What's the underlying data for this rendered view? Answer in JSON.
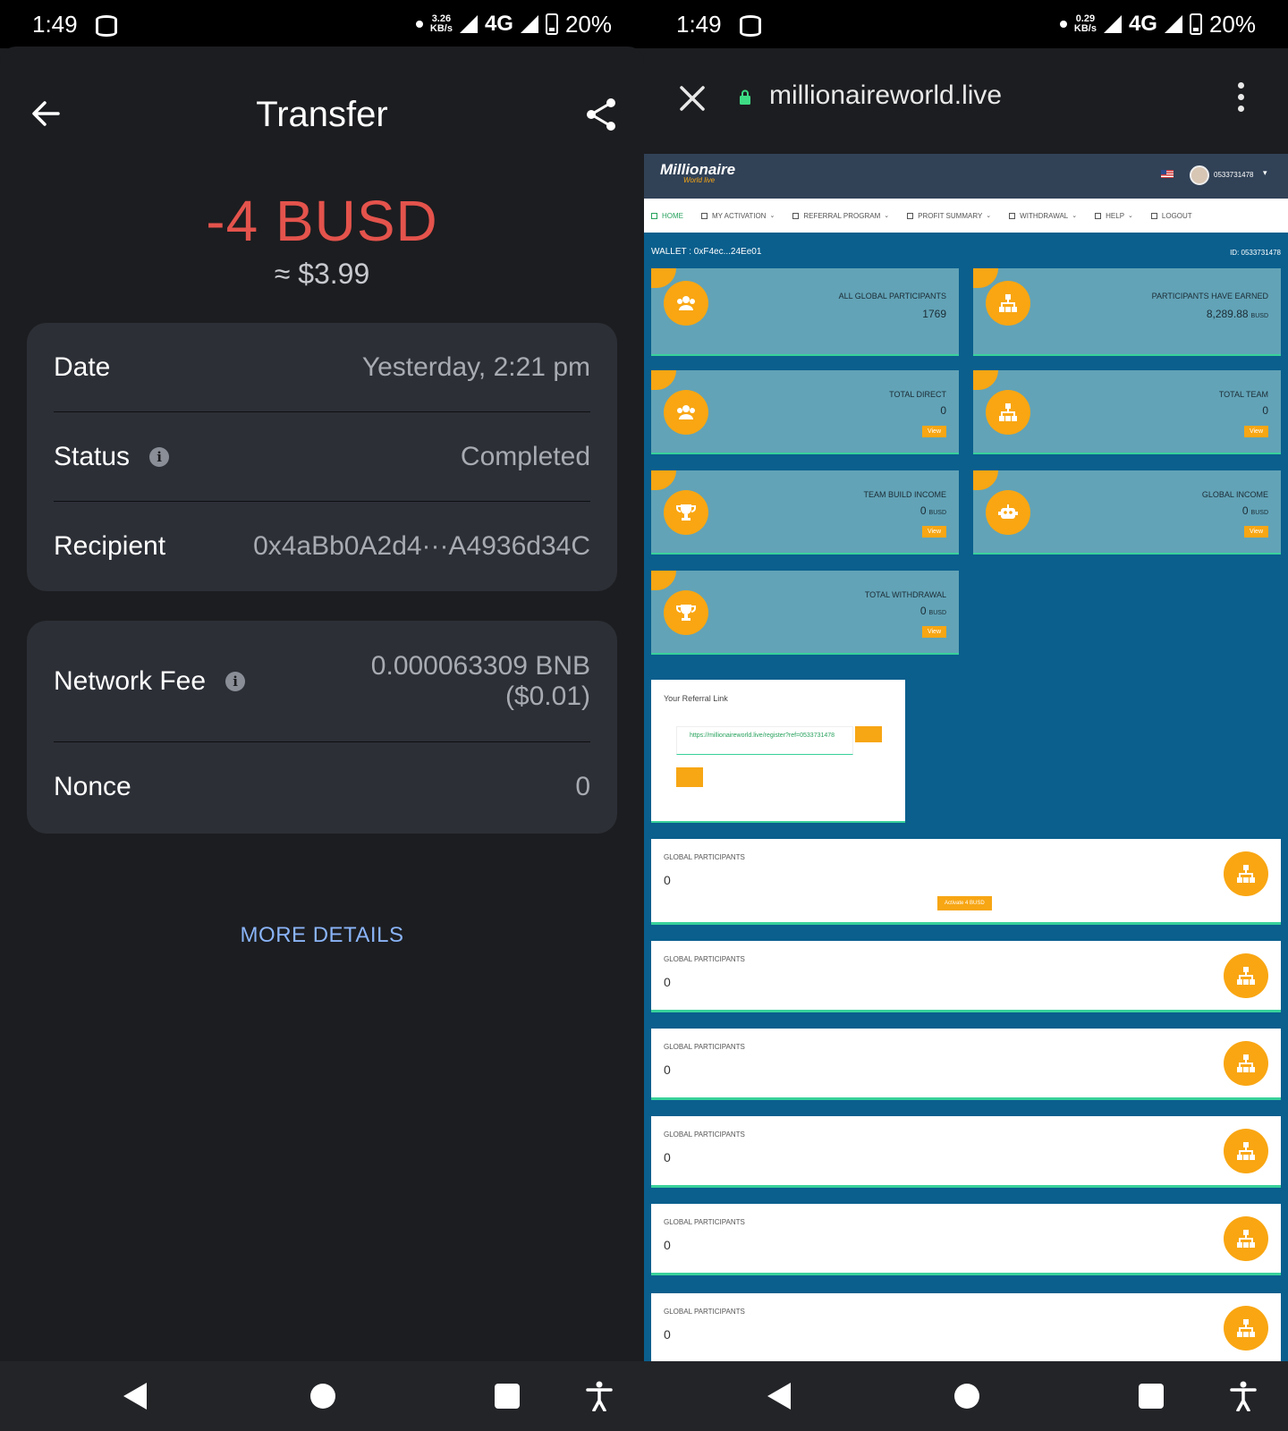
{
  "left": {
    "status": {
      "time": "1:49",
      "speed_top": "3.26",
      "speed_bottom": "KB/s",
      "network": "4G",
      "battery": "20%"
    },
    "header": {
      "title": "Transfer"
    },
    "amount": "-4 BUSD",
    "fiat": "≈ $3.99",
    "details": [
      {
        "label": "Date",
        "value": "Yesterday, 2:21 pm"
      },
      {
        "label": "Status",
        "value": "Completed"
      },
      {
        "label": "Recipient",
        "value": "0x4aBb0A2d4···A4936d34C"
      }
    ],
    "fees": {
      "network_fee_label": "Network Fee",
      "network_fee_value": "0.000063309 BNB",
      "network_fee_fiat": "($0.01)",
      "nonce_label": "Nonce",
      "nonce_value": "0"
    },
    "more_details": "MORE DETAILS",
    "colors": {
      "amount": "#e4534c",
      "link": "#8ab4f8"
    }
  },
  "right": {
    "status": {
      "time": "1:49",
      "speed_top": "0.29",
      "speed_bottom": "KB/s",
      "network": "4G",
      "battery": "20%"
    },
    "browser": {
      "url": "millionaireworld.live"
    },
    "site": {
      "logo": "Millionaire",
      "logo_sub": "World live",
      "user_id": "0533731478",
      "menu": [
        "HOME",
        "MY ACTIVATION",
        "REFERRAL PROGRAM",
        "PROFIT SUMMARY",
        "WITHDRAWAL",
        "HELP",
        "LOGOUT"
      ],
      "wallet": "WALLET : 0xF4ec...24Ee01",
      "id_label": "ID: 0533731478",
      "stats": [
        {
          "title": "ALL GLOBAL PARTICIPANTS",
          "value": "1769",
          "unit": "",
          "view": ""
        },
        {
          "title": "PARTICIPANTS HAVE EARNED",
          "value": "8,289.88",
          "unit": "BUSD",
          "view": ""
        },
        {
          "title": "TOTAL DIRECT",
          "value": "0",
          "unit": "",
          "view": "View"
        },
        {
          "title": "TOTAL TEAM",
          "value": "0",
          "unit": "",
          "view": "View"
        },
        {
          "title": "TEAM BUILD INCOME",
          "value": "0",
          "unit": "BUSD",
          "view": "View"
        },
        {
          "title": "GLOBAL INCOME",
          "value": "0",
          "unit": "BUSD",
          "view": "View"
        },
        {
          "title": "TOTAL WITHDRAWAL",
          "value": "0",
          "unit": "BUSD",
          "view": "View"
        }
      ],
      "referral": {
        "title": "Your Referral Link",
        "link": "https://millionaireworld.live/register?ref=0533731478"
      },
      "global_label": "GLOBAL PARTICIPANTS",
      "global_value": "0",
      "activate": "Activate 4 BUSD"
    }
  }
}
